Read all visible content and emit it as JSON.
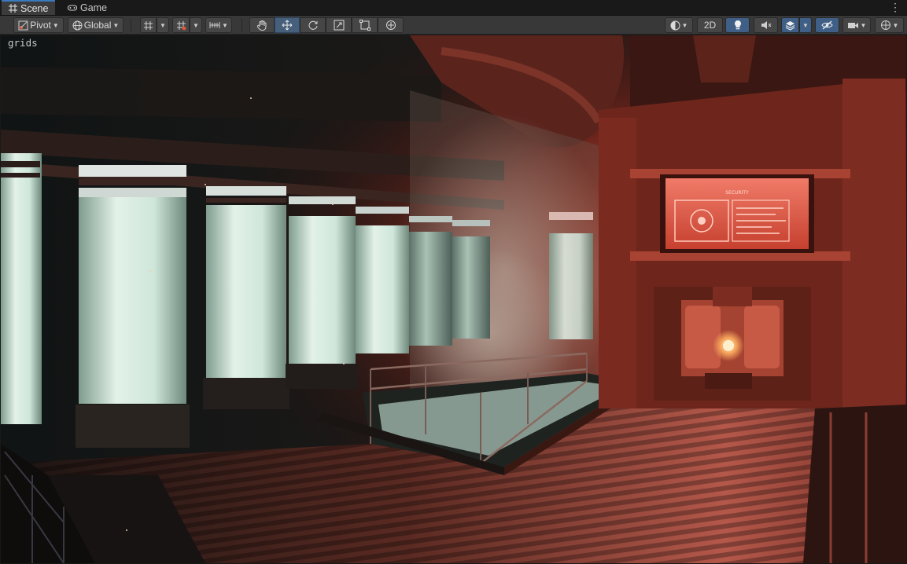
{
  "tabs": [
    {
      "label": "Scene",
      "icon": "hash-icon",
      "active": true
    },
    {
      "label": "Game",
      "icon": "gamepad-icon",
      "active": false
    }
  ],
  "toolbar": {
    "pivot_label": "Pivot",
    "global_label": "Global",
    "two_d_label": "2D"
  },
  "viewport": {
    "overlay_label": "grids",
    "screen_title": "SECURITY"
  },
  "colors": {
    "accent": "#3a79bb",
    "toolbar_bg": "#383838",
    "selected_tool": "#46607c",
    "scene_red": "#c24a36"
  }
}
